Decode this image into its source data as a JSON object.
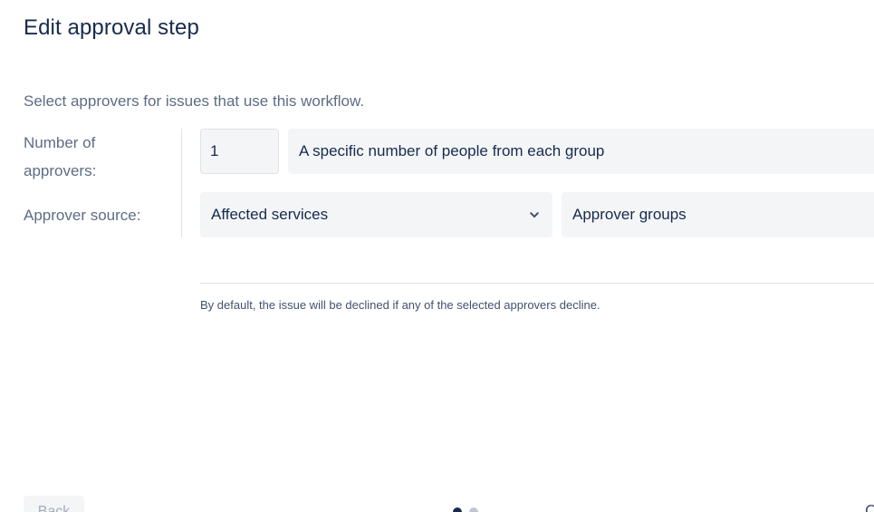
{
  "dialog": {
    "title": "Edit approval step",
    "description": "Select approvers for issues that use this workflow."
  },
  "form": {
    "number_label": "Number of approvers:",
    "number_value": "1",
    "number_mode": "A specific number of people from each group",
    "source_label": "Approver source:",
    "source_value": "Affected services",
    "group_value": "Approver groups"
  },
  "note": "By default, the issue will be declined if any of the selected approvers decline.",
  "footer": {
    "back_label": "Back",
    "next_fragment": "C",
    "pager": {
      "current": 1,
      "total": 2
    }
  },
  "icons": {
    "source_dropdown": "chevron-down-icon"
  }
}
